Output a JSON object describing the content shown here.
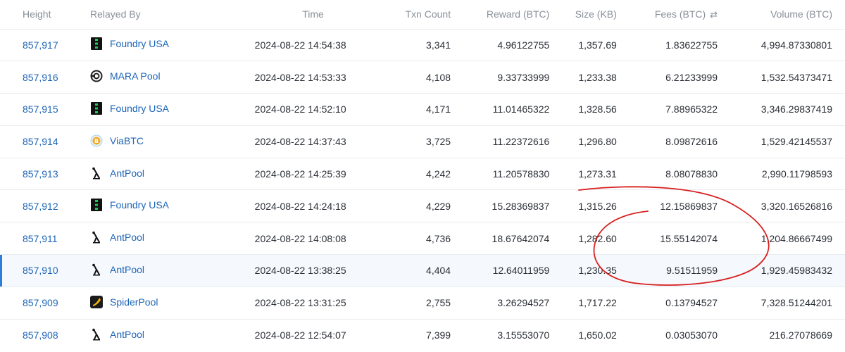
{
  "columns": {
    "height": "Height",
    "relayed_by": "Relayed By",
    "time": "Time",
    "txn_count": "Txn Count",
    "reward": "Reward (BTC)",
    "size": "Size (KB)",
    "fees": "Fees (BTC)",
    "volume": "Volume (BTC)"
  },
  "rows": [
    {
      "height": "857,917",
      "pool": "Foundry USA",
      "pool_icon": "foundry-icon",
      "time": "2024-08-22 14:54:38",
      "txn": "3,341",
      "reward": "4.96122755",
      "size": "1,357.69",
      "fees": "1.83622755",
      "volume": "4,994.87330801"
    },
    {
      "height": "857,916",
      "pool": "MARA Pool",
      "pool_icon": "mara-icon",
      "time": "2024-08-22 14:53:33",
      "txn": "4,108",
      "reward": "9.33733999",
      "size": "1,233.38",
      "fees": "6.21233999",
      "volume": "1,532.54373471"
    },
    {
      "height": "857,915",
      "pool": "Foundry USA",
      "pool_icon": "foundry-icon",
      "time": "2024-08-22 14:52:10",
      "txn": "4,171",
      "reward": "11.01465322",
      "size": "1,328.56",
      "fees": "7.88965322",
      "volume": "3,346.29837419"
    },
    {
      "height": "857,914",
      "pool": "ViaBTC",
      "pool_icon": "viabtc-icon",
      "time": "2024-08-22 14:37:43",
      "txn": "3,725",
      "reward": "11.22372616",
      "size": "1,296.80",
      "fees": "8.09872616",
      "volume": "1,529.42145537"
    },
    {
      "height": "857,913",
      "pool": "AntPool",
      "pool_icon": "antpool-icon",
      "time": "2024-08-22 14:25:39",
      "txn": "4,242",
      "reward": "11.20578830",
      "size": "1,273.31",
      "fees": "8.08078830",
      "volume": "2,990.11798593"
    },
    {
      "height": "857,912",
      "pool": "Foundry USA",
      "pool_icon": "foundry-icon",
      "time": "2024-08-22 14:24:18",
      "txn": "4,229",
      "reward": "15.28369837",
      "size": "1,315.26",
      "fees": "12.15869837",
      "volume": "3,320.16526816"
    },
    {
      "height": "857,911",
      "pool": "AntPool",
      "pool_icon": "antpool-icon",
      "time": "2024-08-22 14:08:08",
      "txn": "4,736",
      "reward": "18.67642074",
      "size": "1,282.60",
      "fees": "15.55142074",
      "volume": "1,204.86667499"
    },
    {
      "height": "857,910",
      "pool": "AntPool",
      "pool_icon": "antpool-icon",
      "time": "2024-08-22 13:38:25",
      "txn": "4,404",
      "reward": "12.64011959",
      "size": "1,230.35",
      "fees": "9.51511959",
      "volume": "1,929.45983432"
    },
    {
      "height": "857,909",
      "pool": "SpiderPool",
      "pool_icon": "spiderpool-icon",
      "time": "2024-08-22 13:31:25",
      "txn": "2,755",
      "reward": "3.26294527",
      "size": "1,717.22",
      "fees": "0.13794527",
      "volume": "7,328.51244201"
    },
    {
      "height": "857,908",
      "pool": "AntPool",
      "pool_icon": "antpool-icon",
      "time": "2024-08-22 12:54:07",
      "txn": "7,399",
      "reward": "3.15553070",
      "size": "1,650.02",
      "fees": "0.03053070",
      "volume": "216.27078669"
    }
  ],
  "selected_row_index": 7,
  "colors": {
    "link": "#1d65b8",
    "annotation": "#d81e1e",
    "selected_bar": "#2e7dd7"
  }
}
